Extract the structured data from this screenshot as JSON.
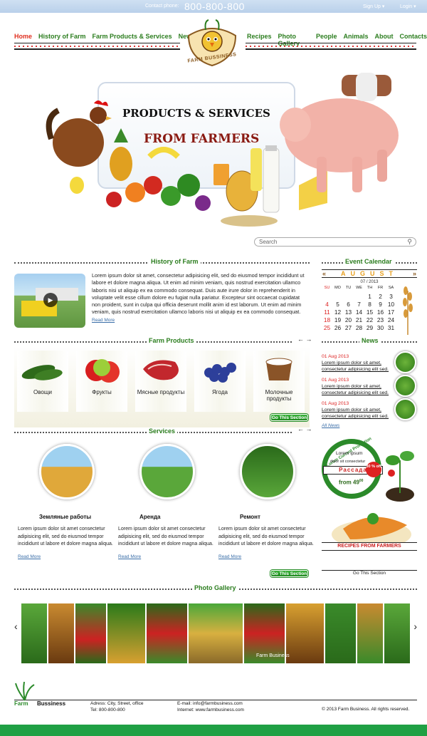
{
  "topbar": {
    "contact_label": "Contact phone:",
    "phone": "800-800-800",
    "signup": "Sign Up",
    "login": "Login"
  },
  "nav": {
    "left": [
      "Home",
      "History of Farm",
      "Farm Products & Services",
      "News"
    ],
    "right": [
      "Recipes",
      "Photo Gallery",
      "People",
      "Animals",
      "About",
      "Contacts"
    ]
  },
  "logo": {
    "text": "FARM BUSSINESS"
  },
  "hero": {
    "line1": "PRODUCTS & SERVICES",
    "line2": "FROM FARMERS"
  },
  "search": {
    "placeholder": "Search"
  },
  "history": {
    "title": "History of Farm",
    "text": "Lorem ipsum dolor sit amet, consectetur adipisicing elit, sed do eiusmod tempor incididunt ut labore et dolore magna aliqua. Ut enim ad minim veniam, quis nostrud exercitation ullamco laboris nisi ut aliquip ex ea commodo consequat. Duis aute irure dolor in reprehenderit in voluptate velit esse cillum dolore eu fugiat nulla pariatur. Excepteur sint occaecat cupidatat non proident, sunt in culpa qui officia deserunt mollit anim id est laborum. Ut enim ad minim veniam, quis nostrud exercitation ullamco laboris nisi ut aliquip ex ea commodo consequat.",
    "more": "Read More"
  },
  "products": {
    "title": "Farm Products",
    "items": [
      "Овощи",
      "Фрукты",
      "Мясные продукты",
      "Ягода",
      "Молочные продукты"
    ],
    "button": "Go This Section"
  },
  "services": {
    "title": "Services",
    "items": [
      {
        "name": "Земляные работы",
        "text": "Lorem ipsum dolor sit amet consectetur adipisicing elit, sed do eiusmod tempor incididunt ut labore et dolore magna aliqua.",
        "more": "Read More"
      },
      {
        "name": "Аренда",
        "text": "Lorem ipsum dolor sit amet consectetur adipisicing elit, sed do eiusmod tempor incididunt ut labore et dolore magna aliqua.",
        "more": "Read More"
      },
      {
        "name": "Ремонт",
        "text": "Lorem ipsum dolor sit amet consectetur adipisicing elit, sed do eiusmod tempor incididunt ut labore et dolore magna aliqua.",
        "more": "Read More"
      }
    ],
    "button": "Go This Section"
  },
  "calendar": {
    "title": "Event Calendar",
    "month": "AUGUST",
    "year": "07 / 2013",
    "days": [
      "SU",
      "MO",
      "TU",
      "WE",
      "TH",
      "FR",
      "SA"
    ],
    "weeks": [
      [
        "",
        "",
        "",
        "",
        "1",
        "2",
        "3"
      ],
      [
        "4",
        "5",
        "6",
        "7",
        "8",
        "9",
        "10"
      ],
      [
        "11",
        "12",
        "13",
        "14",
        "15",
        "16",
        "17"
      ],
      [
        "18",
        "19",
        "20",
        "21",
        "22",
        "23",
        "24"
      ],
      [
        "25",
        "26",
        "27",
        "28",
        "29",
        "30",
        "31"
      ]
    ]
  },
  "news": {
    "title": "News",
    "items": [
      {
        "date": "01 Aug 2013",
        "text": "Lorem ipsum dolor sit amet, consectetur adipisicing elit sed."
      },
      {
        "date": "01 Aug 2013",
        "text": "Lorem ipsum dolor sit amet, consectetur adipisicing elit sed."
      },
      {
        "date": "01 Aug 2013",
        "text": "Lorem ipsum dolor sit amet, consectetur adipisicing elit sed."
      }
    ],
    "all": "All News"
  },
  "promo": {
    "ring": "Lorem Current Promotion",
    "line1": "Lorem ipsum",
    "line2": "dolor sit consectetur",
    "banner": "Рассада",
    "badge": "30 % off",
    "price": "from 49",
    "price_sup": "00"
  },
  "recipes": {
    "title": "RECIPES FROM FARMERS",
    "link": "Go This Section"
  },
  "gallery": {
    "title": "Photo Gallery",
    "caption": "Farm Business"
  },
  "footer": {
    "brand1": "Farm",
    "brand2": "Bussiness",
    "address": "Adress: City, Street, office",
    "tel": "Tel: 800-800-800",
    "email": "E-mail: info@farmbusiness.com",
    "internet": "Internet: www.farmbusiness.com",
    "copyright": "© 2013 Farm Business.  All rights reserved."
  }
}
